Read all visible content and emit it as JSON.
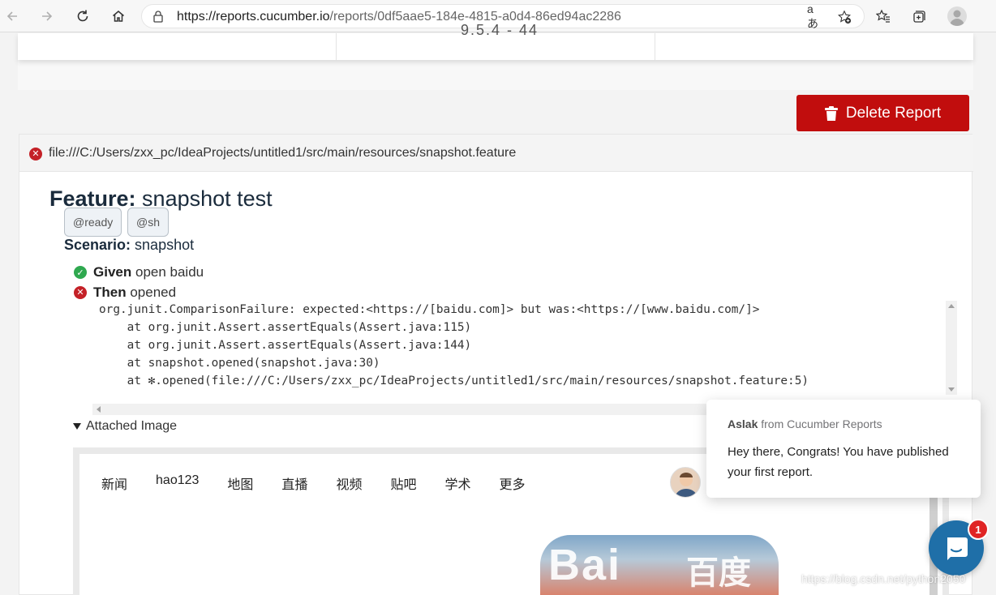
{
  "browser": {
    "url_host": "https://reports.cucumber.io",
    "url_path": "/reports/0df5aae5-184e-4815-a0d4-86ed94ac2286",
    "icons": [
      "back-icon",
      "forward-icon",
      "refresh-icon",
      "home-icon",
      "lock-icon",
      "read-aloud-icon",
      "add-favorite-icon",
      "favorites-icon",
      "collections-icon",
      "profile-icon"
    ]
  },
  "summary": {
    "partial_text": "9.5.4 - 44"
  },
  "actions": {
    "delete_label": "Delete Report"
  },
  "report": {
    "file_path": "file:///C:/Users/zxx_pc/IdeaProjects/untitled1/src/main/resources/snapshot.feature",
    "feature_keyword": "Feature:",
    "feature_name": "snapshot test",
    "tags": [
      "@ready",
      "@sh"
    ],
    "scenario_keyword": "Scenario:",
    "scenario_name": "snapshot",
    "steps": [
      {
        "keyword": "Given",
        "text": "open baidu",
        "status": "passed"
      },
      {
        "keyword": "Then",
        "text": "opened",
        "status": "failed"
      }
    ],
    "stack_trace": [
      "org.junit.ComparisonFailure: expected:<https://[baidu.com]> but was:<https://[www.baidu.com/]>",
      "    at org.junit.Assert.assertEquals(Assert.java:115)",
      "    at org.junit.Assert.assertEquals(Assert.java:144)",
      "    at snapshot.opened(snapshot.java:30)",
      "    at ✻.opened(file:///C:/Users/zxx_pc/IdeaProjects/untitled1/src/main/resources/snapshot.feature:5)"
    ],
    "attached_label": "Attached Image"
  },
  "snapshot": {
    "nav": [
      "新闻",
      "hao123",
      "地图",
      "直播",
      "视频",
      "贴吧",
      "学术",
      "更多"
    ],
    "logo_latin": "Bai",
    "logo_cn": "百度"
  },
  "chat": {
    "sender": "Aslak",
    "from_text": " from Cucumber Reports",
    "message": "Hey there, Congrats! You have published your first report.",
    "badge_count": "1"
  },
  "watermark": "https://blog.csdn.net/python2050",
  "colors": {
    "delete_red": "#c10d0d",
    "failed_red": "#c42127",
    "passed_green": "#2fa84f",
    "launcher_blue": "#1f6fa8"
  }
}
